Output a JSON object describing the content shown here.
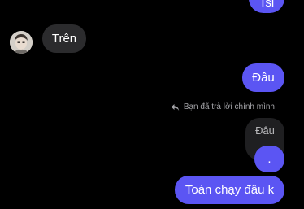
{
  "chat": {
    "messages": [
      {
        "id": "top_outgoing",
        "direction": "outgoing",
        "text": "Tsi"
      },
      {
        "id": "tren",
        "direction": "incoming",
        "text": "Trên"
      },
      {
        "id": "dau",
        "direction": "outgoing",
        "text": "Đâu"
      },
      {
        "id": "reply_quote",
        "direction": "quoted",
        "text": "Đâu"
      },
      {
        "id": "dot",
        "direction": "outgoing",
        "text": "."
      },
      {
        "id": "toan_chay",
        "direction": "outgoing",
        "text": "Toàn chạy đâu k"
      }
    ],
    "reply_note": "Bạn đã trả lời chính mình",
    "icons": {
      "reply": "reply-arrow-icon",
      "avatar": "contact-avatar"
    }
  },
  "colors": {
    "background": "#000000",
    "outgoing_bubble": "#5b55f3",
    "incoming_bubble": "#2b2b2d",
    "quoted_bubble": "#1f1f21",
    "meta_text": "#a4a4a8"
  }
}
